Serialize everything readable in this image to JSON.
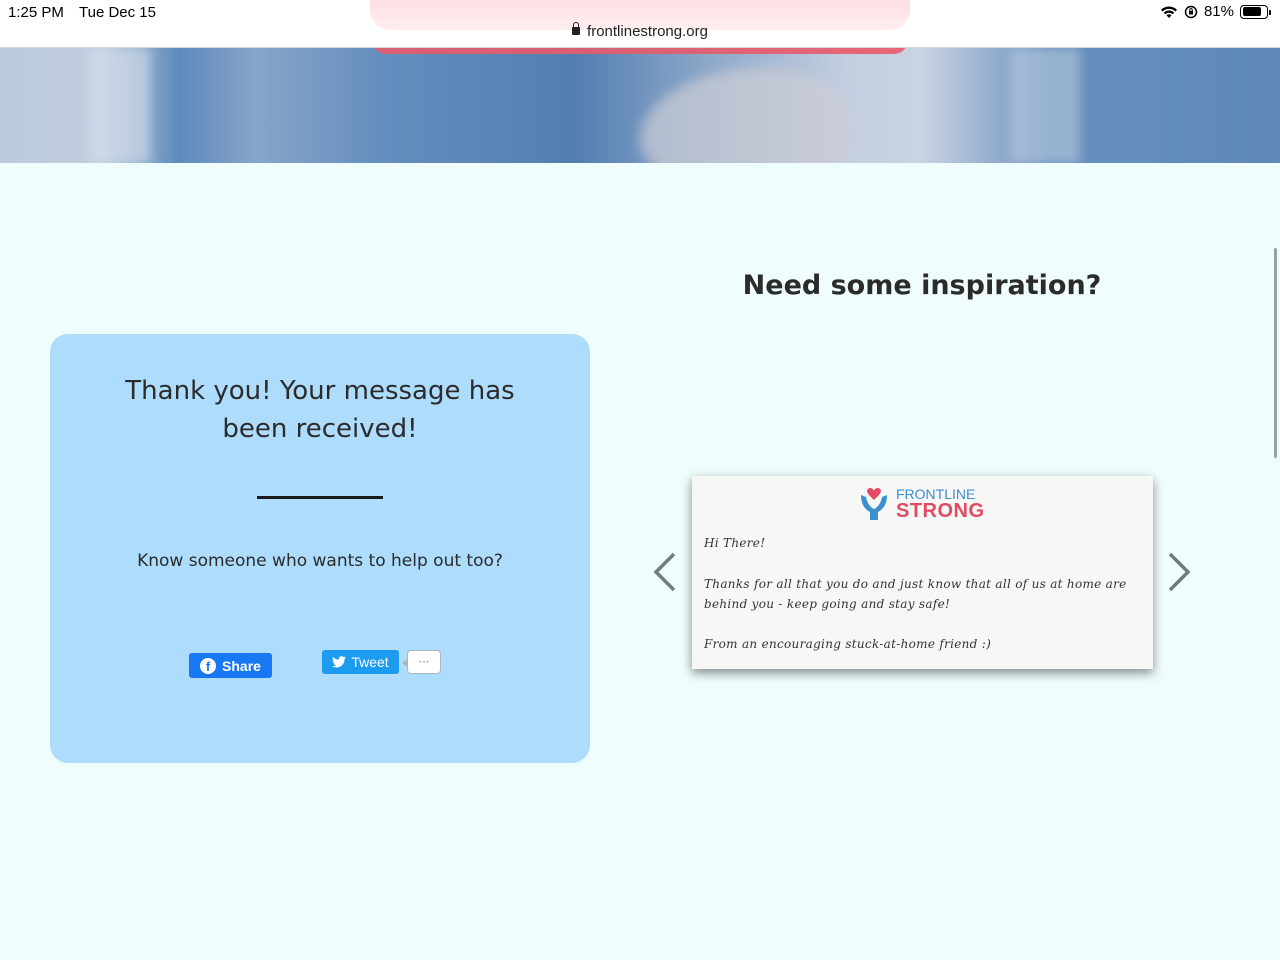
{
  "status_bar": {
    "time": "1:25 PM",
    "date": "Tue Dec 15",
    "battery": "81%",
    "battery_level": 0.81
  },
  "browser": {
    "url": "frontlinestrong.org"
  },
  "thanks_card": {
    "title": "Thank you! Your message has been received!",
    "help_text": "Know someone who wants to help out too?",
    "share_label": "Share",
    "tweet_label": "Tweet",
    "tweet_count": "···"
  },
  "inspiration": {
    "heading": "Need some inspiration?",
    "logo_line1": "FRONTLINE",
    "logo_line2": "STRONG",
    "letter": {
      "greeting": "Hi There!",
      "body_line1": "Thanks for all that you do and just know that all of us at home are",
      "body_line2": "behind you - keep going and stay safe!",
      "signoff": "From an encouraging stuck-at-home friend :)"
    }
  },
  "colors": {
    "page_bg": "#effdfd",
    "card_bg": "#aedcfd",
    "facebook": "#1877f2",
    "twitter": "#1d9bf0",
    "brand_blue": "#3c8fd1",
    "brand_red": "#e34a63"
  }
}
